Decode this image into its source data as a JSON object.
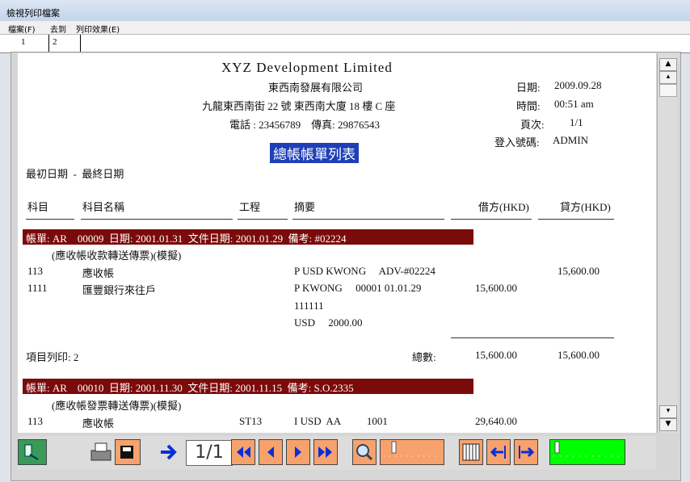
{
  "window": {
    "title": "檢視列印檔案"
  },
  "menu": {
    "items": [
      "檔案(F)",
      "去到",
      "列印效果(E)"
    ]
  },
  "tabs": [
    "1",
    "2"
  ],
  "report": {
    "company_name": "XYZ Development Limited",
    "company_name_zh": "東西南發展有限公司",
    "address": "九龍東西南街 22 號 東西南大廈 18 樓 C 座",
    "phone_fax": "電話 : 23456789    傳真: 29876543",
    "date_label": "日期:",
    "date_value": "2009.09.28",
    "time_label": "時間:",
    "time_value": "00:51 am",
    "page_label": "頁次:",
    "page_value": "1/1",
    "login_label": "登入號碼:",
    "login_value": "ADMIN",
    "report_title": "總帳帳單列表",
    "date_range": "最初日期  -  最終日期",
    "columns": {
      "account": "科目",
      "account_name": "科目名稱",
      "project": "工程",
      "summary": "摘要",
      "debit": "借方(HKD)",
      "credit": "貸方(HKD)"
    },
    "voucher1": {
      "header": "帳單: AR    00009  日期: 2001.01.31  文件日期: 2001.01.29  備考: #02224",
      "desc": "(應收帳收款轉送傳票)(模擬)",
      "lines": [
        {
          "account": "113",
          "name": "應收帳",
          "project": "",
          "summary": "P USD KWONG     ADV-#02224",
          "debit": "",
          "credit": "15,600.00"
        },
        {
          "account": "1111",
          "name": "匯豐銀行來往戶",
          "project": "",
          "summary": "P KWONG     00001 01.01.29",
          "debit": "15,600.00",
          "credit": ""
        }
      ],
      "summary_extra1": "111111",
      "summary_extra2": "USD     2000.00",
      "item_count": "項目列印: 2",
      "total_label": "總數:",
      "total_debit": "15,600.00",
      "total_credit": "15,600.00"
    },
    "voucher2": {
      "header": "帳單: AR    00010  日期: 2001.11.30  文件日期: 2001.11.15  備考: S.O.2335",
      "desc": "(應收帳發票轉送傳票)(模擬)",
      "line": {
        "account": "113",
        "name": "應收帳",
        "project": "ST13",
        "summary": "I USD  AA          1001",
        "debit": "29,640.00",
        "credit": ""
      }
    }
  },
  "toolbar": {
    "page_indicator": "1/1"
  },
  "colors": {
    "banner": "#1f3fb7",
    "voucher_band": "#7b0b0b",
    "toolbar_orange": "#f7a26c",
    "toolbar_green": "#00ff00",
    "arrow_blue": "#0a2fd8"
  }
}
